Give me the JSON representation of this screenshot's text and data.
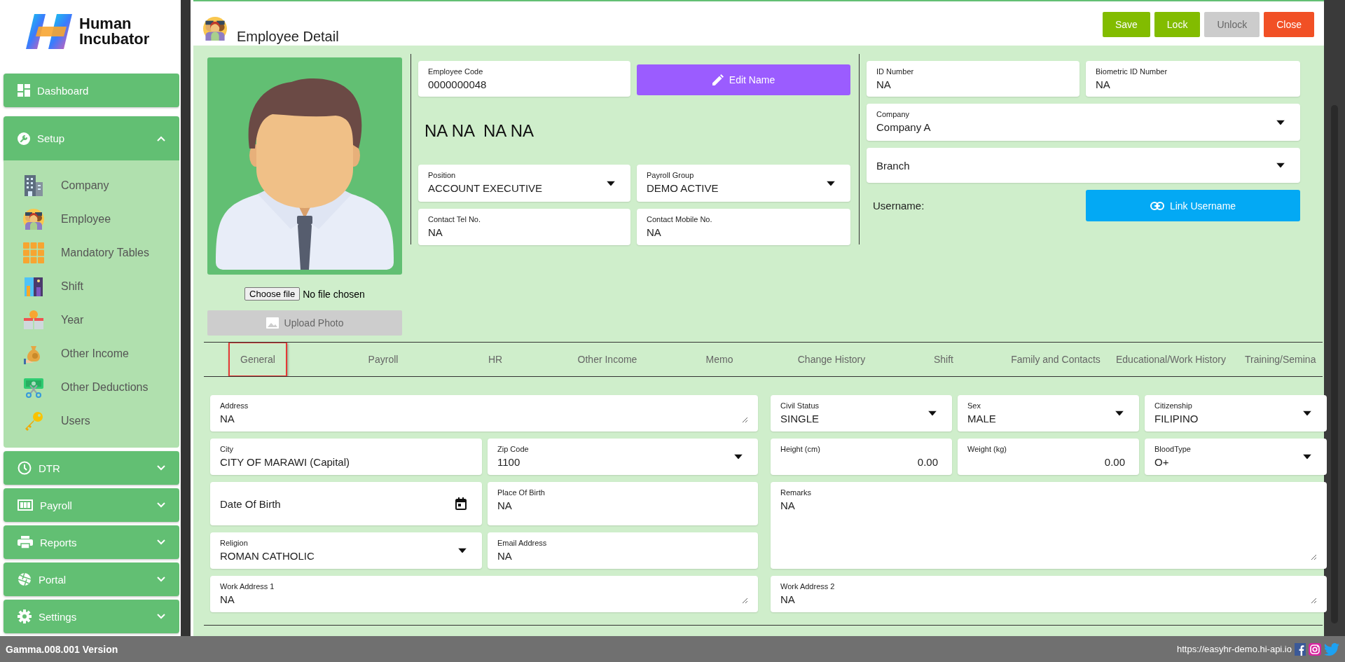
{
  "sidebar": {
    "logo": {
      "line_1": "Human",
      "line_2": "Incubator"
    },
    "items": [
      {
        "kind": "link",
        "label": "Dashboard"
      },
      {
        "kind": "group",
        "label": "Setup",
        "expanded": true,
        "children": [
          {
            "label": "Company"
          },
          {
            "label": "Employee"
          },
          {
            "label": "Mandatory Tables"
          },
          {
            "label": "Shift"
          },
          {
            "label": "Year"
          },
          {
            "label": "Other Income"
          },
          {
            "label": "Other Deductions"
          },
          {
            "label": "Users"
          }
        ]
      },
      {
        "kind": "group",
        "label": "DTR",
        "expanded": false
      },
      {
        "kind": "group",
        "label": "Payroll",
        "expanded": false
      },
      {
        "kind": "group",
        "label": "Reports",
        "expanded": false
      },
      {
        "kind": "group",
        "label": "Portal",
        "expanded": false
      },
      {
        "kind": "group",
        "label": "Settings",
        "expanded": false
      }
    ]
  },
  "header": {
    "title": "Employee Detail",
    "buttons": [
      {
        "label": "Save",
        "color": "#82bc00",
        "disabled": false
      },
      {
        "label": "Lock",
        "color": "#82bc00",
        "disabled": false
      },
      {
        "label": "Unlock",
        "color": "#cccccc",
        "disabled": true
      },
      {
        "label": "Close",
        "color": "#f15025",
        "disabled": false
      }
    ]
  },
  "profile": {
    "choose_file_button": "Choose file",
    "file_status": "No file chosen",
    "upload_button": {
      "label": "Upload Photo",
      "disabled": true
    }
  },
  "details": {
    "employee_code": {
      "kind": "text",
      "label": "Employee Code",
      "value": "0000000048"
    },
    "edit_name_button": "Edit Name",
    "full_name": "NA NA  NA NA",
    "position": {
      "kind": "select",
      "label": "Position",
      "value": "ACCOUNT EXECUTIVE"
    },
    "payroll_group": {
      "kind": "select",
      "label": "Payroll Group",
      "value": "DEMO ACTIVE"
    },
    "contact_tel": {
      "kind": "text",
      "label": "Contact Tel No.",
      "value": "NA"
    },
    "contact_mobile": {
      "kind": "text",
      "label": "Contact Mobile No.",
      "value": "NA"
    },
    "id_number": {
      "kind": "text",
      "label": "ID Number",
      "value": "NA"
    },
    "biometric_id": {
      "kind": "text",
      "label": "Biometric ID Number",
      "value": "NA"
    },
    "company": {
      "kind": "select",
      "label": "Company",
      "value": "Company A"
    },
    "branch": {
      "kind": "select",
      "placeholder": "Branch"
    },
    "username_label": "Username:",
    "link_username_button": "Link Username"
  },
  "tabs": [
    {
      "label": "General",
      "selected": true
    },
    {
      "label": "Payroll",
      "selected": false
    },
    {
      "label": "HR",
      "selected": false
    },
    {
      "label": "Other Income",
      "selected": false
    },
    {
      "label": "Memo",
      "selected": false
    },
    {
      "label": "Change History",
      "selected": false
    },
    {
      "label": "Shift",
      "selected": false
    },
    {
      "label": "Family and Contacts",
      "selected": false
    },
    {
      "label": "Educational/Work History",
      "selected": false
    },
    {
      "label": "Training/Semina",
      "selected": false
    }
  ],
  "general_form": {
    "left_rows": [
      [
        {
          "kind": "textarea",
          "label": "Address",
          "value": "NA"
        }
      ],
      [
        {
          "kind": "text",
          "label": "City",
          "value": "CITY OF MARAWI (Capital)"
        },
        {
          "kind": "select",
          "label": "Zip Code",
          "value": "1100"
        }
      ],
      [
        {
          "kind": "date",
          "placeholder": "Date Of Birth"
        },
        {
          "kind": "text",
          "label": "Place Of Birth",
          "value": "NA"
        }
      ],
      [
        {
          "kind": "select",
          "label": "Religion",
          "value": "ROMAN CATHOLIC"
        },
        {
          "kind": "text",
          "label": "Email Address",
          "value": "NA"
        }
      ],
      [
        {
          "kind": "textarea",
          "label": "Work Address 1",
          "value": "NA"
        }
      ]
    ],
    "right_rows": [
      [
        {
          "kind": "select",
          "label": "Civil Status",
          "value": "SINGLE"
        },
        {
          "kind": "select",
          "label": "Sex",
          "value": "MALE"
        },
        {
          "kind": "select",
          "label": "Citizenship",
          "value": "FILIPINO"
        }
      ],
      [
        {
          "kind": "number",
          "label": "Height (cm)",
          "value": "0.00"
        },
        {
          "kind": "number",
          "label": "Weight (kg)",
          "value": "0.00"
        },
        {
          "kind": "select",
          "label": "BloodType",
          "value": "O+"
        }
      ],
      [
        {
          "kind": "textarea",
          "label": "Remarks",
          "value": "NA"
        }
      ],
      [
        {
          "kind": "textarea",
          "label": "Work Address 2",
          "value": "NA"
        }
      ]
    ]
  },
  "footer": {
    "version": "Gamma.008.001 Version",
    "url": "https://easyhr-demo.hi-api.io"
  }
}
